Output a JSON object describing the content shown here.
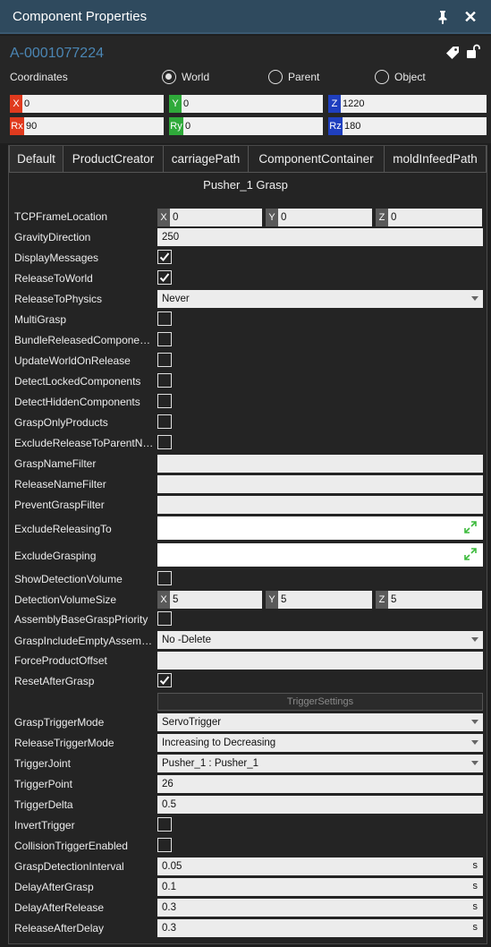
{
  "window": {
    "title": "Component Properties"
  },
  "component": {
    "name": "A-0001077224"
  },
  "coordinates": {
    "label": "Coordinates",
    "options": [
      {
        "label": "World",
        "selected": true
      },
      {
        "label": "Parent",
        "selected": false
      },
      {
        "label": "Object",
        "selected": false
      }
    ]
  },
  "pose": {
    "x": {
      "badge": "X",
      "value": "0"
    },
    "y": {
      "badge": "Y",
      "value": "0"
    },
    "z": {
      "badge": "Z",
      "value": "1220"
    },
    "rx": {
      "badge": "Rx",
      "value": "90"
    },
    "ry": {
      "badge": "Ry",
      "value": "0"
    },
    "rz": {
      "badge": "Rz",
      "value": "180"
    }
  },
  "tabs": [
    "Default",
    "ProductCreator",
    "carriagePath",
    "ComponentContainer",
    "moldInfeedPath"
  ],
  "section": {
    "title": "Pusher_1 Grasp"
  },
  "props": {
    "tcp_frame_location": {
      "label": "TCPFrameLocation",
      "x": "0",
      "y": "0",
      "z": "0",
      "xb": "X",
      "yb": "Y",
      "zb": "Z"
    },
    "gravity_direction": {
      "label": "GravityDirection",
      "value": "250"
    },
    "display_messages": {
      "label": "DisplayMessages",
      "checked": true
    },
    "release_to_world": {
      "label": "ReleaseToWorld",
      "checked": true
    },
    "release_to_physics": {
      "label": "ReleaseToPhysics",
      "value": "Never"
    },
    "multi_grasp": {
      "label": "MultiGrasp",
      "checked": false
    },
    "bundle_released": {
      "label": "BundleReleasedComponents",
      "checked": false
    },
    "update_world": {
      "label": "UpdateWorldOnRelease",
      "checked": false
    },
    "detect_locked": {
      "label": "DetectLockedComponents",
      "checked": false
    },
    "detect_hidden": {
      "label": "DetectHiddenComponents",
      "checked": false
    },
    "grasp_only_products": {
      "label": "GraspOnlyProducts",
      "checked": false
    },
    "exclude_release_parent": {
      "label": "ExcludeReleaseToParentNo...",
      "checked": false
    },
    "grasp_name_filter": {
      "label": "GraspNameFilter",
      "value": ""
    },
    "release_name_filter": {
      "label": "ReleaseNameFilter",
      "value": ""
    },
    "prevent_grasp_filter": {
      "label": "PreventGraspFilter",
      "value": ""
    },
    "exclude_releasing_to": {
      "label": "ExcludeReleasingTo",
      "value": ""
    },
    "exclude_grasping": {
      "label": "ExcludeGrasping",
      "value": ""
    },
    "show_detection_volume": {
      "label": "ShowDetectionVolume",
      "checked": false
    },
    "detection_volume_size": {
      "label": "DetectionVolumeSize",
      "x": "5",
      "y": "5",
      "z": "5",
      "xb": "X",
      "yb": "Y",
      "zb": "Z"
    },
    "assembly_base_priority": {
      "label": "AssemblyBaseGraspPriority",
      "checked": false
    },
    "grasp_include_empty": {
      "label": "GraspIncludeEmptyAssembl...",
      "value": "No -Delete"
    },
    "force_product_offset": {
      "label": "ForceProductOffset",
      "value": ""
    },
    "reset_after_grasp": {
      "label": "ResetAfterGrasp",
      "checked": true
    },
    "trigger_settings": {
      "label": "TriggerSettings"
    },
    "grasp_trigger_mode": {
      "label": "GraspTriggerMode",
      "value": "ServoTrigger"
    },
    "release_trigger_mode": {
      "label": "ReleaseTriggerMode",
      "value": "Increasing to Decreasing"
    },
    "trigger_joint": {
      "label": "TriggerJoint",
      "value": "Pusher_1 : Pusher_1"
    },
    "trigger_point": {
      "label": "TriggerPoint",
      "value": "26"
    },
    "trigger_delta": {
      "label": "TriggerDelta",
      "value": "0.5"
    },
    "invert_trigger": {
      "label": "InvertTrigger",
      "checked": false
    },
    "collision_trigger": {
      "label": "CollisionTriggerEnabled",
      "checked": false
    },
    "grasp_detection_interval": {
      "label": "GraspDetectionInterval",
      "value": "0.05",
      "unit": "s"
    },
    "delay_after_grasp": {
      "label": "DelayAfterGrasp",
      "value": "0.1",
      "unit": "s"
    },
    "delay_after_release": {
      "label": "DelayAfterRelease",
      "value": "0.3",
      "unit": "s"
    },
    "release_after_delay": {
      "label": "ReleaseAfterDelay",
      "value": "0.3",
      "unit": "s"
    }
  },
  "icons": {
    "pin": "pin-icon",
    "close": "close-icon",
    "tag": "tag-icon",
    "lock": "unlock-icon",
    "expand": "expand-icon",
    "check": "check-icon"
  },
  "colors": {
    "title_bar": "#2f4a5e",
    "component_name": "#4b86b4",
    "x_axis": "#e03a1e",
    "y_axis": "#2faa3a",
    "z_axis": "#1f3fbf",
    "expand_icon": "#3dbb3d"
  }
}
